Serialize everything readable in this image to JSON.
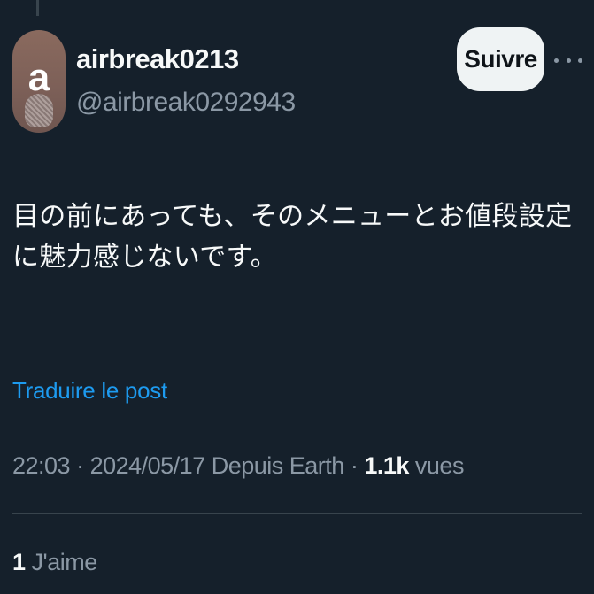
{
  "author": {
    "avatar_letter": "a",
    "display_name": "airbreak0213",
    "handle": "@airbreak0292943"
  },
  "header": {
    "follow_label": "Suivre",
    "more_icon": "more-horizontal-icon"
  },
  "post": {
    "text": "目の前にあっても、そのメニューとお値段設定に魅力感じないです。",
    "translate_label": "Traduire le post"
  },
  "meta": {
    "time": "22:03",
    "separator1": " · ",
    "date": "2024/05/17",
    "source": "Depuis Earth",
    "separator2": " · ",
    "views_count": "1.1k",
    "views_label": "vues"
  },
  "engagement": {
    "likes_count": "1",
    "likes_label": "J'aime"
  },
  "colors": {
    "background": "#15202b",
    "text_primary": "#f7f9f9",
    "text_secondary": "#8b98a5",
    "link": "#1d9bf0",
    "follow_bg": "#eff3f4"
  }
}
